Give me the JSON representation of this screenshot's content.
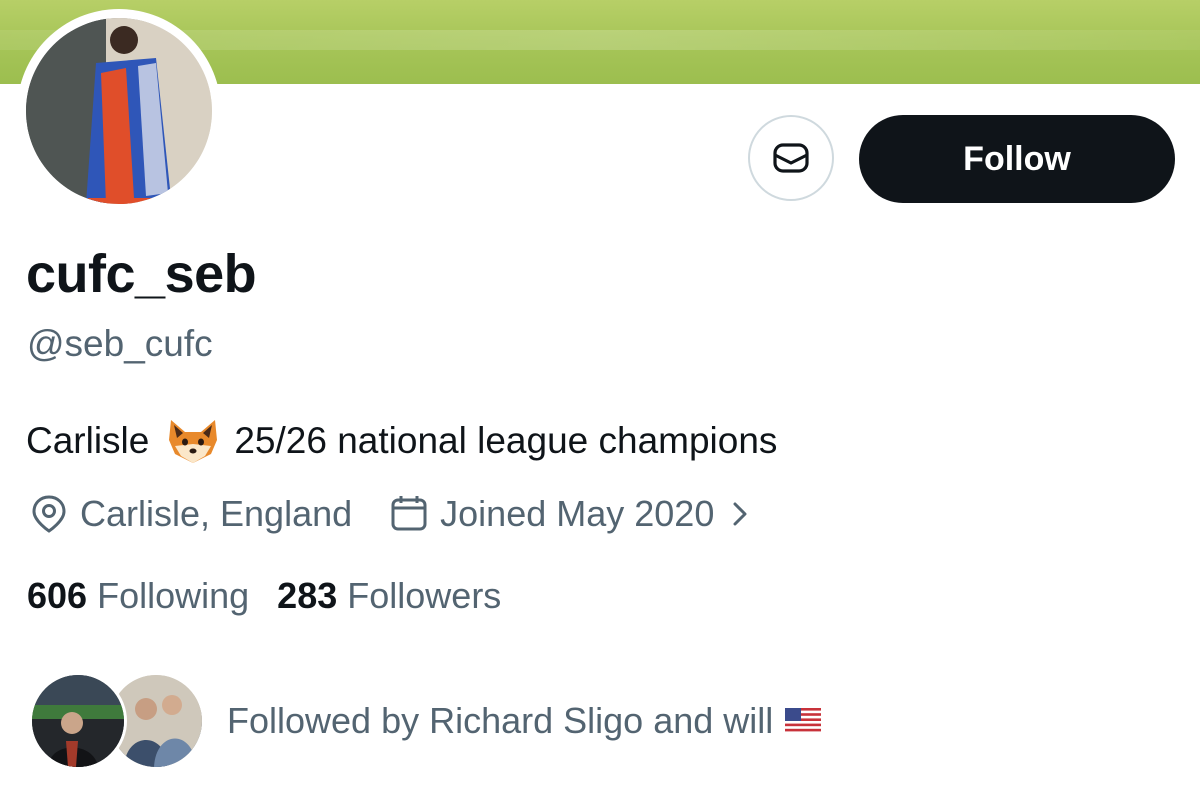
{
  "profile": {
    "display_name": "cufc_seb",
    "handle": "@seb_cufc",
    "bio_before": "Carlisle",
    "bio_emoji": "fox-face",
    "bio_after": "25/26 national league champions",
    "location": "Carlisle, England",
    "joined": "Joined May 2020"
  },
  "actions": {
    "follow_label": "Follow",
    "message_icon": "envelope-icon"
  },
  "stats": {
    "following_count": "606",
    "following_label": "Following",
    "followers_count": "283",
    "followers_label": "Followers"
  },
  "followed_by": {
    "text": "Followed by Richard Sligo and will",
    "flag": "us-flag"
  },
  "colors": {
    "text_primary": "#0f1419",
    "text_secondary": "#536471",
    "button_dark": "#0f1419",
    "border": "#cfd9de",
    "banner": "#a8c659"
  }
}
